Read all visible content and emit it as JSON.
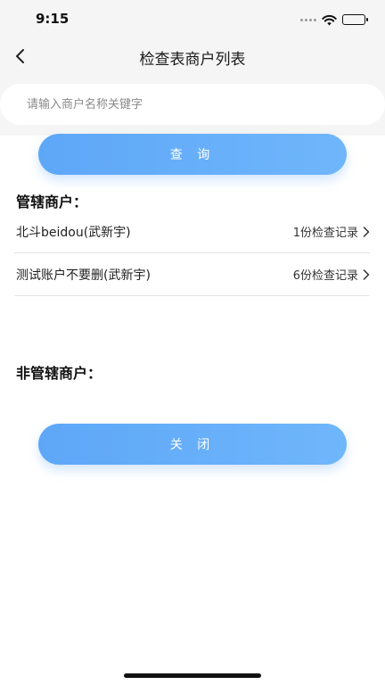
{
  "status_bar": {
    "time": "9:15"
  },
  "nav": {
    "title": "检查表商户列表"
  },
  "search": {
    "placeholder": "请输入商户名称关键字",
    "value": ""
  },
  "query_button": {
    "label": "查 询"
  },
  "managed_section": {
    "title": "管辖商户：",
    "merchants": [
      {
        "name": "北斗beidou(武新宇)",
        "records": "1份检查记录"
      },
      {
        "name": "测试账户不要删(武新宇)",
        "records": "6份检查记录"
      }
    ]
  },
  "unmanaged_section": {
    "title": "非管辖商户："
  },
  "close_button": {
    "label": "关 闭"
  },
  "colors": {
    "accent": "#62abf8",
    "background": "#ffffff",
    "header_bg": "#f5f5f5"
  }
}
